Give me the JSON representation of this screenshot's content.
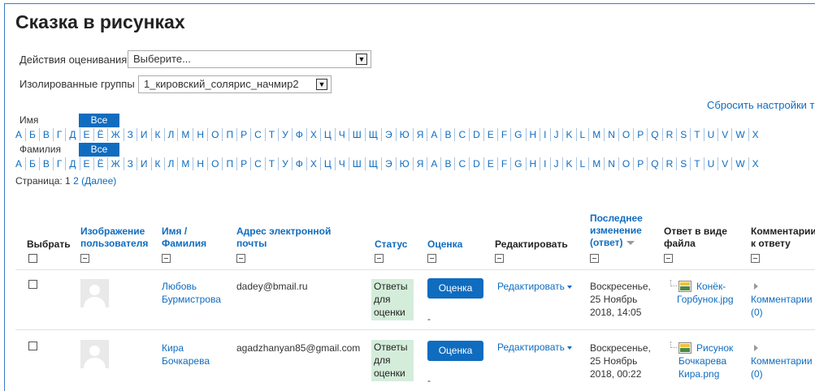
{
  "page": {
    "title": "Сказка в рисунках"
  },
  "controls": {
    "grading_action_label": "Действия оценивания",
    "grading_action_value": "Выберите...",
    "groups_label": "Изолированные группы",
    "groups_value": "1_кировский_солярис_начмир2",
    "reset_link": "Сбросить настройки та"
  },
  "filters": {
    "first_name_label": "Имя",
    "last_name_label": "Фамилия",
    "all_label": "Все",
    "letters": [
      "А",
      "Б",
      "В",
      "Г",
      "Д",
      "Е",
      "Ё",
      "Ж",
      "З",
      "И",
      "К",
      "Л",
      "М",
      "Н",
      "О",
      "П",
      "Р",
      "С",
      "Т",
      "У",
      "Ф",
      "Х",
      "Ц",
      "Ч",
      "Ш",
      "Щ",
      "Э",
      "Ю",
      "Я",
      "A",
      "B",
      "C",
      "D",
      "E",
      "F",
      "G",
      "H",
      "I",
      "J",
      "K",
      "L",
      "M",
      "N",
      "O",
      "P",
      "Q",
      "R",
      "S",
      "T",
      "U",
      "V",
      "W",
      "X"
    ]
  },
  "paging": {
    "prefix": "Страница: 1",
    "page2": "2",
    "next": "(Далее)"
  },
  "table": {
    "headers": {
      "select": "Выбрать",
      "image_line1": "Изображение",
      "image_line2": "пользователя",
      "name_line1": "Имя /",
      "name_line2": "Фамилия",
      "email_line1": "Адрес электронной",
      "email_line2": "почты",
      "status": "Статус",
      "grade": "Оценка",
      "edit": "Редактировать",
      "modified_line1": "Последнее",
      "modified_line2": "изменение",
      "modified_line3": "(ответ)",
      "file_line1": "Ответ в виде",
      "file_line2": "файла",
      "comments_line1": "Комментарии",
      "comments_line2": "к ответу"
    },
    "rows": [
      {
        "first_name": "Любовь",
        "last_name": "Бурмистрова",
        "email": "dadey@bmail.ru",
        "status_l1": "Ответы",
        "status_l2": "для",
        "status_l3": "оценки",
        "grade_button": "Оценка",
        "grade_value": "-",
        "edit_link": "Редактировать",
        "date_l1": "Воскресенье,",
        "date_l2": "25 Ноябрь",
        "date_l3": "2018, 14:05",
        "file_l1": "Конёк-",
        "file_l2": "Горбунок.jpg",
        "comments_l1": "Комментарии",
        "comments_l2": "(0)"
      },
      {
        "first_name": "Кира",
        "last_name": "Бочкарева",
        "email": "agadzhanyan85@gmail.com",
        "status_l1": "Ответы",
        "status_l2": "для",
        "status_l3": "оценки",
        "grade_button": "Оценка",
        "grade_value": "-",
        "edit_link": "Редактировать",
        "date_l1": "Воскресенье,",
        "date_l2": "25 Ноябрь",
        "date_l3": "2018, 00:22",
        "file_l1": "Рисунок",
        "file_l2": "Бочкарева",
        "file_l3": "Кира.png",
        "comments_l1": "Комментарии",
        "comments_l2": "(0)"
      }
    ]
  },
  "colors": {
    "link": "#0f6cbf",
    "status_bg": "#d4edda",
    "button_bg": "#0f6cbf"
  }
}
